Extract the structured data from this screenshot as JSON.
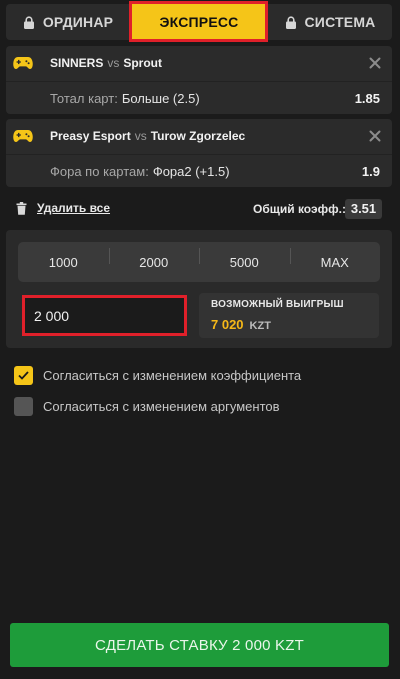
{
  "tabs": [
    {
      "label": "ОРДИНАР",
      "active": false,
      "icon": "lock-icon"
    },
    {
      "label": "ЭКСПРЕСС",
      "active": true
    },
    {
      "label": "СИСТЕМА",
      "active": false,
      "icon": "lock-icon"
    }
  ],
  "bets": [
    {
      "team1": "SINNERS",
      "vs": "vs",
      "team2": "Sprout",
      "market": "Тотал карт:",
      "selection": "Больше (2.5)",
      "odd": "1.85",
      "icon": "gamepad-icon"
    },
    {
      "team1": "Preasy Esport",
      "vs": "vs",
      "team2": "Turow Zgorzelec",
      "market": "Фора по картам:",
      "selection": "Фора2 (+1.5)",
      "odd": "1.9",
      "icon": "gamepad-icon"
    }
  ],
  "delete_all": "Удалить все",
  "total_label": "Общий коэфф.:",
  "total_odd": "3.51",
  "quick_stakes": [
    "1000",
    "2000",
    "5000",
    "MAX"
  ],
  "stake_value": "2 000",
  "possible_win": {
    "title": "ВОЗМОЖНЫЙ ВЫИГРЫШ",
    "amount": "7 020",
    "currency": "KZT"
  },
  "checkboxes": [
    {
      "label": "Согласиться с изменением коэффициента",
      "checked": true
    },
    {
      "label": "Согласиться с изменением аргументов",
      "checked": false
    }
  ],
  "submit_label": "СДЕЛАТЬ СТАВКУ 2 000 KZT",
  "colors": {
    "accent": "#f5c518",
    "highlight": "#e0202a",
    "submit": "#1e9c3a",
    "win": "#f5b818"
  }
}
